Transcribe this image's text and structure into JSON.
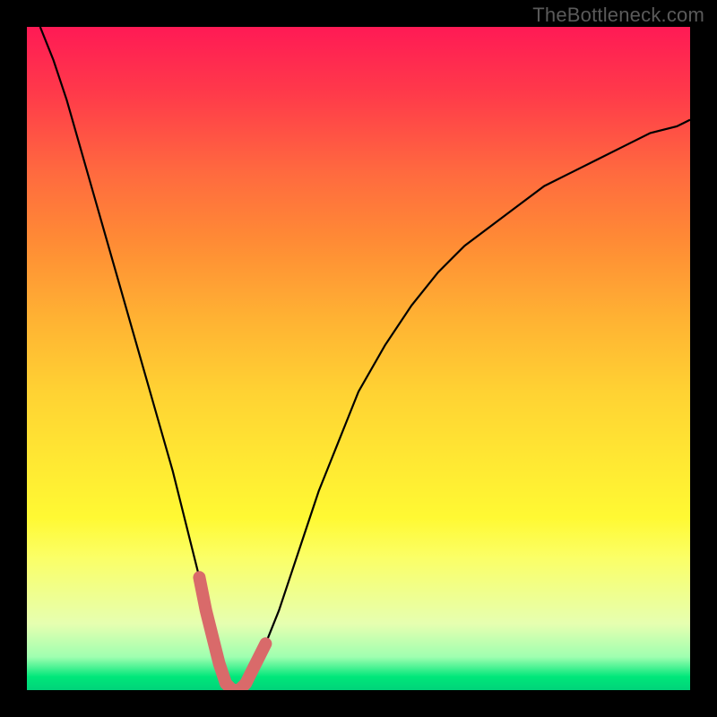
{
  "watermark": "TheBottleneck.com",
  "colors": {
    "background": "#000000",
    "curve": "#000000",
    "highlight": "#d96a6a",
    "gradient_stops": [
      "#ff1a55",
      "#ff3a4a",
      "#ff6a3f",
      "#ff8a35",
      "#ffb233",
      "#ffd233",
      "#ffe733",
      "#fff933",
      "#fbff66",
      "#e6ffb0",
      "#9fffb0",
      "#00e77a",
      "#00d37a"
    ]
  },
  "chart_data": {
    "type": "line",
    "title": "",
    "xlabel": "",
    "ylabel": "",
    "xlim": [
      0,
      100
    ],
    "ylim": [
      0,
      100
    ],
    "x": [
      2,
      4,
      6,
      8,
      10,
      12,
      14,
      16,
      18,
      20,
      22,
      24,
      26,
      27,
      28,
      29,
      30,
      31,
      32,
      33,
      34,
      36,
      38,
      40,
      42,
      44,
      46,
      48,
      50,
      54,
      58,
      62,
      66,
      70,
      74,
      78,
      82,
      86,
      90,
      94,
      98,
      100
    ],
    "values": [
      100,
      95,
      89,
      82,
      75,
      68,
      61,
      54,
      47,
      40,
      33,
      25,
      17,
      12,
      8,
      4,
      1,
      0,
      0,
      1,
      3,
      7,
      12,
      18,
      24,
      30,
      35,
      40,
      45,
      52,
      58,
      63,
      67,
      70,
      73,
      76,
      78,
      80,
      82,
      84,
      85,
      86
    ],
    "minimum_x": 31,
    "highlight_x_range": [
      26,
      36
    ],
    "annotations": []
  }
}
